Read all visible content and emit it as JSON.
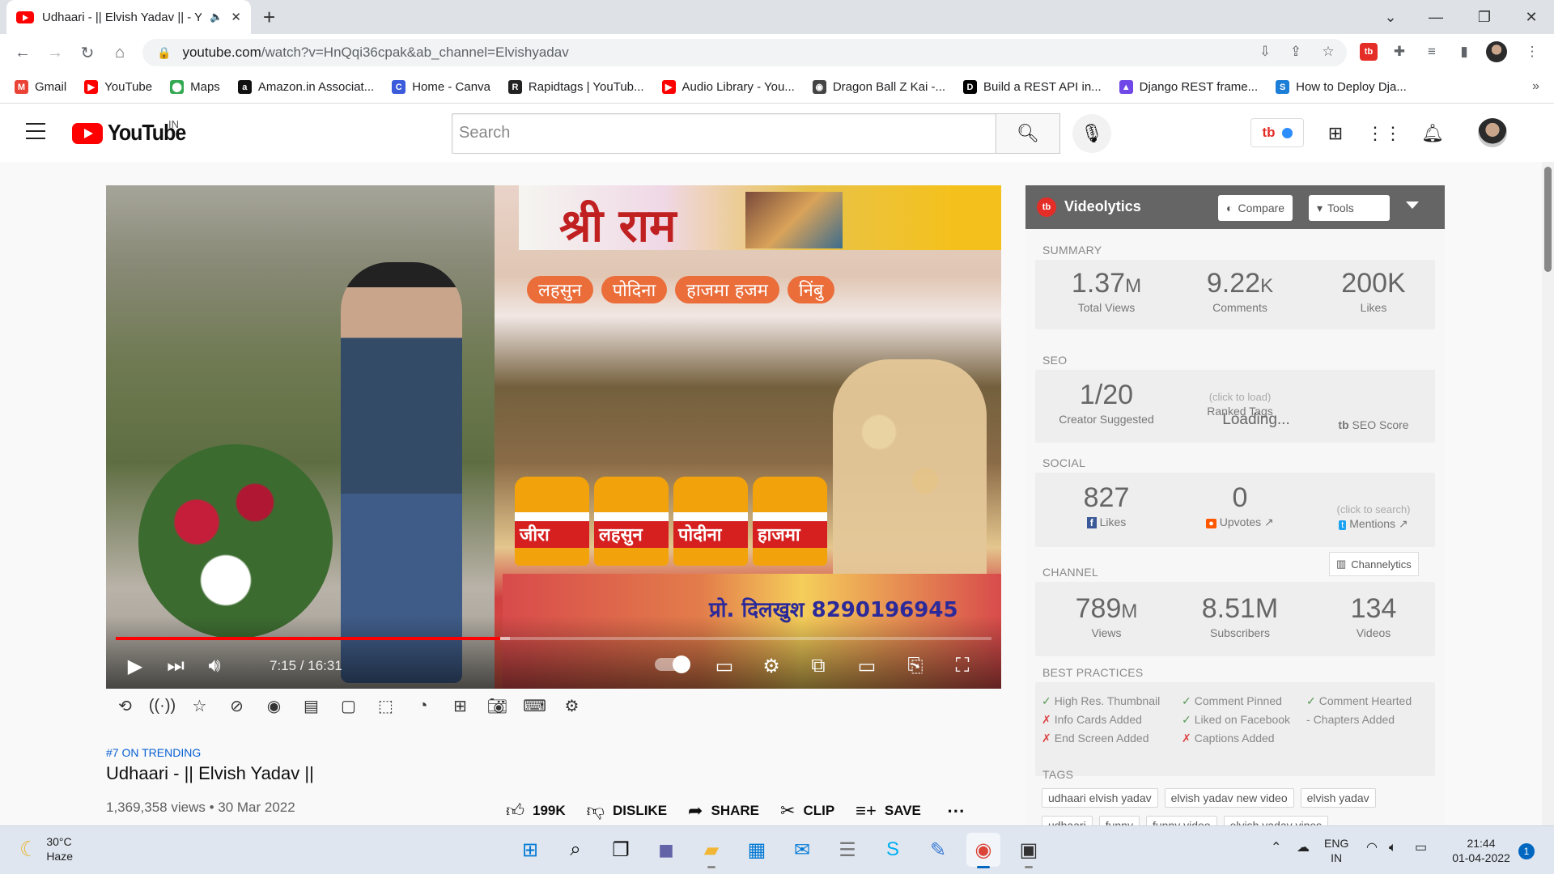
{
  "browser": {
    "tab_title": "Udhaari - || Elvish Yadav || - Y",
    "tab_close": "✕",
    "new_tab": "+",
    "url_host": "youtube.com",
    "url_path": "/watch?v=HnQqi36cpak&ab_channel=Elvishyadav",
    "window": {
      "minimize": "—",
      "restore": "❐",
      "close": "✕",
      "tab_search": "⌄"
    },
    "bookmarks": [
      {
        "label": "Gmail",
        "icon": "gmail-icon",
        "color": "#ea4335",
        "glyph": "M"
      },
      {
        "label": "YouTube",
        "icon": "youtube-icon",
        "color": "#ff0000",
        "glyph": "▶"
      },
      {
        "label": "Maps",
        "icon": "maps-icon",
        "color": "#34a853",
        "glyph": "⬤"
      },
      {
        "label": "Amazon.in Associat...",
        "icon": "amazon-icon",
        "color": "#111111",
        "glyph": "a"
      },
      {
        "label": "Home - Canva",
        "icon": "canva-icon",
        "color": "#3b5bdb",
        "glyph": "C"
      },
      {
        "label": "Rapidtags | YouTub...",
        "icon": "rapidtags-icon",
        "color": "#222222",
        "glyph": "R"
      },
      {
        "label": "Audio Library - You...",
        "icon": "youtube-icon",
        "color": "#ff0000",
        "glyph": "▶"
      },
      {
        "label": "Dragon Ball Z Kai -...",
        "icon": "dragonball-icon",
        "color": "#444444",
        "glyph": "◉"
      },
      {
        "label": "Build a REST API in...",
        "icon": "dev-icon",
        "color": "#000000",
        "glyph": "D"
      },
      {
        "label": "Django REST frame...",
        "icon": "django-icon",
        "color": "#7048e8",
        "glyph": "▲"
      },
      {
        "label": "How to Deploy Dja...",
        "icon": "s-icon",
        "color": "#1c7ed6",
        "glyph": "S"
      }
    ],
    "more_bookmarks": "»"
  },
  "youtube": {
    "logo_text": "YouTube",
    "country": "IN",
    "search_placeholder": "Search"
  },
  "video": {
    "time": "7:15 / 16:31",
    "progress_fraction": 0.439,
    "sign_text": "श्री राम",
    "labels": [
      "लहसुन",
      "पोदिना",
      "हाजमा हजम",
      "निंबु"
    ],
    "jars": [
      "जीरा",
      "लहसुन",
      "पोदीना",
      "हाजमा"
    ],
    "phone": "प्रो. दिलखुश 8290196945"
  },
  "meta": {
    "trending": "#7 ON TRENDING",
    "title": "Udhaari - || Elvish Yadav ||",
    "views_date": "1,369,358 views • 30 Mar 2022",
    "likes": "199K",
    "dislike": "DISLIKE",
    "share": "SHARE",
    "clip": "CLIP",
    "save": "SAVE",
    "more": "⋯"
  },
  "videolytics": {
    "name": "Videolytics",
    "compare": "Compare",
    "tools": "Tools",
    "summary": {
      "heading": "SUMMARY",
      "views_num": "1.37",
      "views_unit": "M",
      "views_label": "Total Views",
      "comments_num": "9.22",
      "comments_unit": "K",
      "comments_label": "Comments",
      "likes_num": "200K",
      "likes_label": "Likes"
    },
    "seo": {
      "heading": "SEO",
      "creator": "1/20",
      "creator_label": "Creator Suggested",
      "ranked_hint": "(click to load)",
      "ranked_label": "Ranked Tags",
      "loading": "Loading...",
      "seo_score": "SEO Score"
    },
    "social": {
      "heading": "SOCIAL",
      "fb_likes": "827",
      "fb_label": "Likes",
      "upvotes": "0",
      "upvotes_label": "Upvotes",
      "mentions_hint": "(click to search)",
      "mentions_label": "Mentions"
    },
    "channel": {
      "heading": "CHANNEL",
      "channelytics": "Channelytics",
      "views_num": "789",
      "views_unit": "M",
      "views_label": "Views",
      "subs": "8.51M",
      "subs_label": "Subscribers",
      "videos": "134",
      "videos_label": "Videos"
    },
    "best": {
      "heading": "BEST PRACTICES",
      "col1": [
        {
          "mark": "✓",
          "text": "High Res. Thumbnail",
          "ok": true
        },
        {
          "mark": "✗",
          "text": "Info Cards Added",
          "ok": false
        },
        {
          "mark": "✗",
          "text": "End Screen Added",
          "ok": false
        }
      ],
      "col2": [
        {
          "mark": "✓",
          "text": "Comment Pinned",
          "ok": true
        },
        {
          "mark": "✓",
          "text": "Liked on Facebook",
          "ok": true
        },
        {
          "mark": "✗",
          "text": "Captions Added",
          "ok": false
        }
      ],
      "col3": [
        {
          "mark": "✓",
          "text": "Comment Hearted",
          "ok": true
        },
        {
          "mark": "-",
          "text": "Chapters Added",
          "ok": null
        }
      ]
    },
    "tags": {
      "heading": "TAGS",
      "items": [
        "udhaari elvish yadav",
        "elvish yadav new video",
        "elvish yadav",
        "udhaari",
        "funny",
        "funny video",
        "elvish yadav vines"
      ]
    }
  },
  "taskbar": {
    "temp": "30°C",
    "condition": "Haze",
    "lang1": "ENG",
    "lang2": "IN",
    "time": "21:44",
    "date": "01-04-2022",
    "notifications": "1"
  }
}
